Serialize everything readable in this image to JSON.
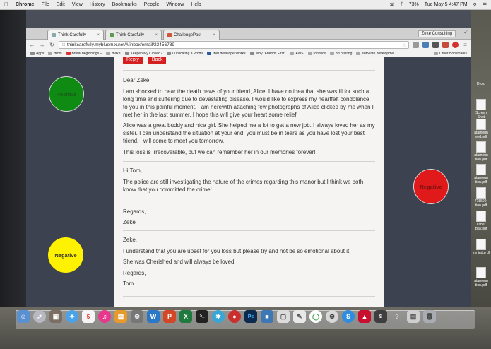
{
  "menubar": {
    "app": "Chrome",
    "menus": [
      "File",
      "Edit",
      "View",
      "History",
      "Bookmarks",
      "People",
      "Window",
      "Help"
    ],
    "battery": "73%",
    "clock": "Tue May 5  4:47 PM"
  },
  "tabs": [
    {
      "label": "Think Carefully",
      "active": true
    },
    {
      "label": "Think Carefully",
      "active": false
    },
    {
      "label": "ChallengePost",
      "active": false
    }
  ],
  "profile": "Zeke Consulting",
  "address": "thinkcarefully.mybluemix.net/#/inbox/email/23456789",
  "bookmarks": [
    {
      "label": "Apps",
      "folder": false
    },
    {
      "label": "drool",
      "folder": true
    },
    {
      "label": "Brutal beginnings –",
      "folder": false
    },
    {
      "label": "make",
      "folder": true
    },
    {
      "label": "Keepen My Closed /",
      "folder": false
    },
    {
      "label": "Duplicating a Produ",
      "folder": false
    },
    {
      "label": "IBM developerWorks",
      "folder": false
    },
    {
      "label": "Why \"Friends First\"",
      "folder": false
    },
    {
      "label": "AWS",
      "folder": true
    },
    {
      "label": "robotics",
      "folder": true
    },
    {
      "label": "3d printing",
      "folder": true
    },
    {
      "label": "software developme",
      "folder": true
    }
  ],
  "other_bookmarks": "Other Bookmarks",
  "email": {
    "reply_label": "Reply",
    "back_label": "Back",
    "messages": [
      {
        "paragraphs": [
          "Dear Zeke,",
          "I am shocked to hear the death news of your friend, Alice. I have no idea that she was ill for such a long time and suffering due to devastating disease. I would like to express my heartfelt condolence to you in this painful moment. I am herewith attaching few photographs of Alice clicked by me when I met her in the last summer. I hope this will give your heart some relief.",
          "Alice was a great buddy and nice girl. She helped me a lot to get a new job. I always loved her as my sister. I can understand the situation at your end; you must be in tears as you have lost your best friend. I will come to meet you tomorrow.",
          "This loss is irrecoverable, but we can remember her in our memories forever!"
        ]
      },
      {
        "paragraphs": [
          "Hi Tom,",
          "The police are still investigating the nature of the crimes regarding this manor but I think we both know that you committed the crime!",
          "",
          "Regards,",
          "Zeke"
        ]
      },
      {
        "paragraphs": [
          "Zeke,",
          "I understand that you are upset for you loss but please try and not be so emotional about it.",
          "She was Cherished and will always be loved",
          "Regards,",
          "Tom"
        ]
      }
    ]
  },
  "sentiment": [
    {
      "label": "Positive",
      "color": "#0f8a12",
      "text_color": "#1a5a1a"
    },
    {
      "label": "Negative",
      "color": "#e01a1a",
      "text_color": "#7a1010"
    },
    {
      "label": "Negative",
      "color": "#fff200",
      "text_color": "#333333"
    }
  ],
  "desktop_files": [
    "Droid",
    "Screen Shot",
    "atamoun ned.pdf",
    "atamoun tion.pdf",
    "atamoun tion.pdf",
    "718599- tion.pdf",
    "Other Bay.pdf",
    "inmind.p df",
    "atamoun tion.pdf"
  ]
}
